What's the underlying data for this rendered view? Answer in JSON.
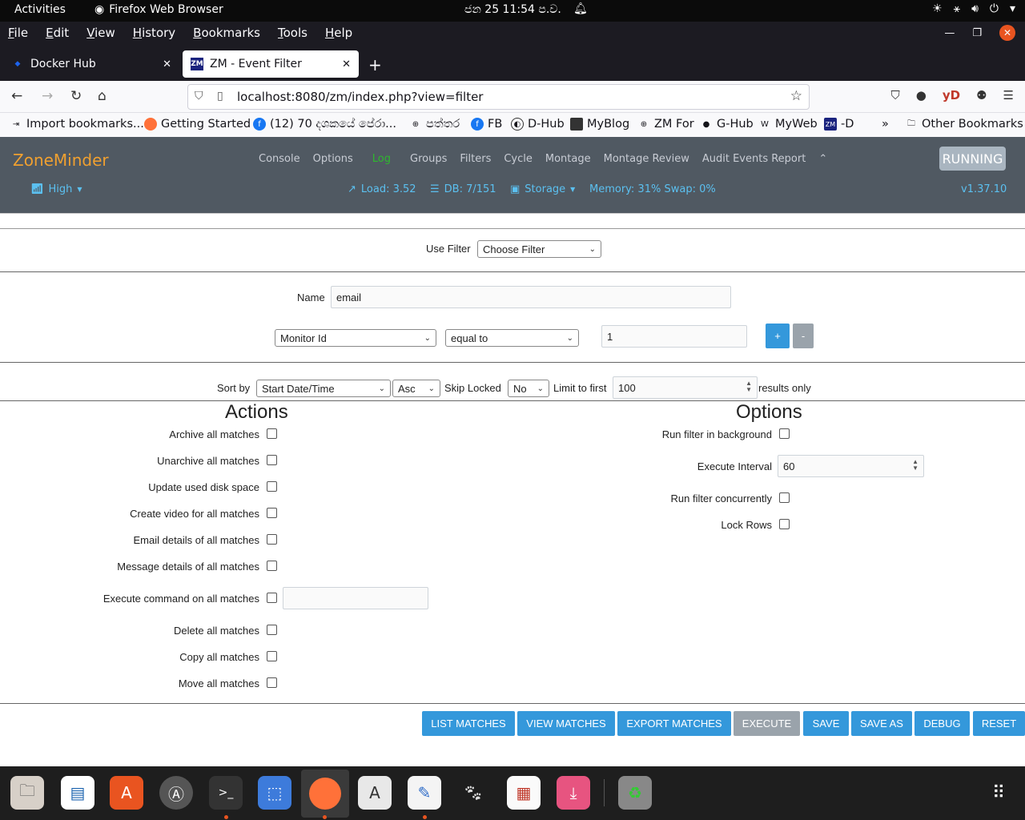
{
  "system": {
    "activities": "Activities",
    "app_name": "Firefox Web Browser",
    "clock": "ජන 25  11:54 ප.ව."
  },
  "menubar": {
    "items": [
      "File",
      "Edit",
      "View",
      "History",
      "Bookmarks",
      "Tools",
      "Help"
    ]
  },
  "tabs": [
    {
      "title": "Docker Hub"
    },
    {
      "title": "ZM - Event Filter",
      "active": true
    }
  ],
  "navbar": {
    "url": "localhost:8080/zm/index.php?view=filter",
    "profile_label": "yD"
  },
  "bookmarks": {
    "items": [
      {
        "label": "Import bookmarks...",
        "icon": "import-icon"
      },
      {
        "label": "Getting Started",
        "icon": "firefox-icon"
      },
      {
        "label": "(12) 70 දශකයේ පේරා...",
        "icon": "facebook-icon"
      },
      {
        "label": "පත්තර",
        "icon": "globe-icon"
      },
      {
        "label": "FB",
        "icon": "facebook-icon"
      },
      {
        "label": "D-Hub",
        "icon": "docker-icon"
      },
      {
        "label": "MyBlog",
        "icon": "blog-icon"
      },
      {
        "label": "ZM For",
        "icon": "globe-icon"
      },
      {
        "label": "G-Hub",
        "icon": "github-icon"
      },
      {
        "label": "MyWeb",
        "icon": "wordpress-icon"
      },
      {
        "label": "-D",
        "icon": "zm-icon"
      }
    ],
    "other": "Other Bookmarks"
  },
  "zm": {
    "logo": "ZoneMinder",
    "menu": [
      "Console",
      "Options",
      "Log",
      "Groups",
      "Filters",
      "Cycle",
      "Montage",
      "Montage Review",
      "Audit Events Report"
    ],
    "active_menu": "Log",
    "status_button": "RUNNING",
    "bandwidth": "High",
    "load": "Load: 3.52",
    "db": "DB: 7/151",
    "storage": "Storage",
    "memory": "Memory: 31% Swap: 0%",
    "version": "v1.37.10"
  },
  "filter": {
    "use_filter_label": "Use Filter",
    "use_filter_value": "Choose Filter",
    "name_label": "Name",
    "name_value": "email",
    "term_attr": "Monitor Id",
    "term_op": "equal to",
    "term_value": "1",
    "add_label": "+",
    "remove_label": "-",
    "sort_by_label": "Sort by",
    "sort_field": "Start Date/Time",
    "sort_dir": "Asc",
    "skip_locked_label": "Skip Locked",
    "skip_locked_value": "No",
    "limit_label": "Limit to first",
    "limit_value": "100",
    "results_only": "results only"
  },
  "actions": {
    "title": "Actions",
    "items": [
      "Archive all matches",
      "Unarchive all matches",
      "Update used disk space",
      "Create video for all matches",
      "Email details of all matches",
      "Message details of all matches",
      "Execute command on all matches",
      "Delete all matches",
      "Copy all matches",
      "Move all matches"
    ]
  },
  "options": {
    "title": "Options",
    "run_background": "Run filter in background",
    "execute_interval_label": "Execute Interval",
    "execute_interval_value": "60",
    "run_concurrently": "Run filter concurrently",
    "lock_rows": "Lock Rows"
  },
  "buttons": {
    "list_matches": "LIST MATCHES",
    "view_matches": "VIEW MATCHES",
    "export_matches": "EXPORT MATCHES",
    "execute": "EXECUTE",
    "save": "SAVE",
    "save_as": "SAVE AS",
    "debug": "DEBUG",
    "reset": "RESET"
  },
  "colors": {
    "zm_nav_bg": "#505962",
    "zm_logo": "#f0a030",
    "button_blue": "#3498db",
    "ubuntu_orange": "#e95420"
  }
}
